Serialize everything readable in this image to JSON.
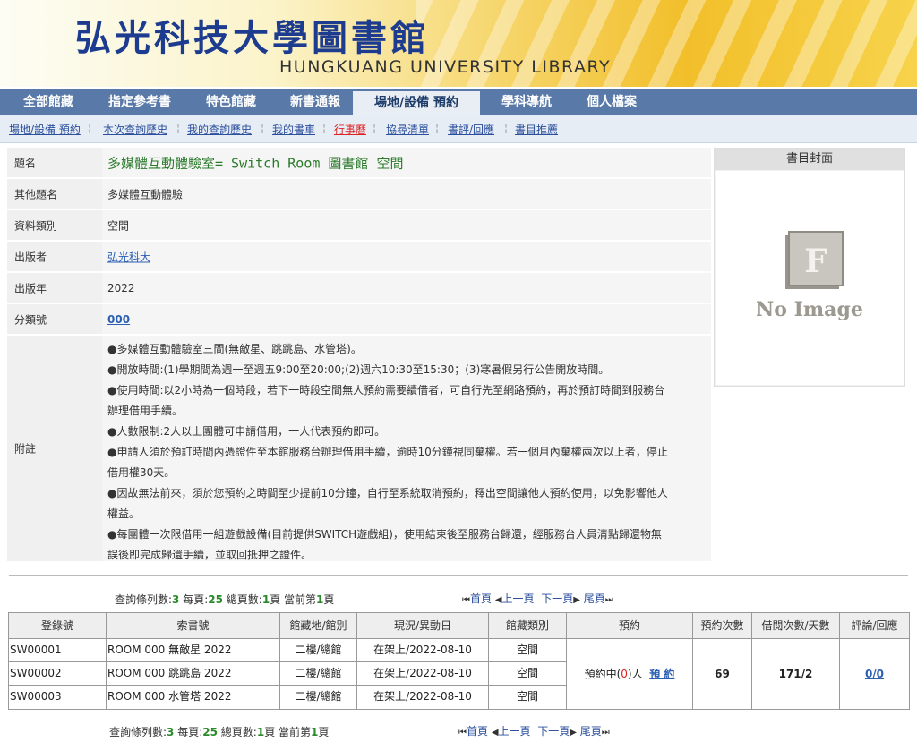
{
  "banner": {
    "title": "弘光科技大學圖書館",
    "subtitle": "HUNGKUANG UNIVERSITY LIBRARY"
  },
  "main_nav": [
    {
      "label": "全部館藏"
    },
    {
      "label": "指定參考書"
    },
    {
      "label": "特色館藏"
    },
    {
      "label": "新書通報"
    },
    {
      "label": "場地/設備 預約",
      "active": true
    },
    {
      "label": "學科導航"
    },
    {
      "label": "個人檔案"
    }
  ],
  "sub_nav": [
    {
      "label": "場地/設備 預約"
    },
    {
      "label": "本次查詢歷史"
    },
    {
      "label": "我的查詢歷史"
    },
    {
      "label": "我的書車"
    },
    {
      "label": "行事曆",
      "color": "#dd2222"
    },
    {
      "label": "協尋清單"
    },
    {
      "label": "書評/回應"
    },
    {
      "label": "書目推薦"
    }
  ],
  "record": {
    "title_label": "題名",
    "title": "多媒體互動體驗室= Switch Room 圖書館 空間",
    "other_title_label": "其他題名",
    "other_title": "多媒體互動體驗",
    "type_label": "資料類別",
    "type": "空間",
    "publisher_label": "出版者",
    "publisher": "弘光科大",
    "year_label": "出版年",
    "year": "2022",
    "class_label": "分類號",
    "class_no": "000",
    "notes_label": "附註",
    "notes": [
      "●多媒體互動體驗室三間(無敵星、跳跳島、水管塔)。",
      "●開放時間:(1)學期間為週一至週五9:00至20:00;(2)週六10:30至15:30；(3)寒暑假另行公告開放時間。",
      "●使用時間:以2小時為一個時段，若下一時段空間無人預約需要續借者，可自行先至網路預約，再於預訂時間到服務台",
      "辦理借用手續。",
      "●人數限制:2人以上團體可申請借用，一人代表預約即可。",
      "●申請人須於預訂時間內憑證件至本館服務台辦理借用手續，逾時10分鐘視同棄權。若一個月內棄權兩次以上者，停止",
      "借用權30天。",
      "●因故無法前來，須於您預約之時間至少提前10分鐘，自行至系統取消預約，釋出空間讓他人預約使用，以免影響他人",
      "權益。",
      "●每團體一次限借用一組遊戲設備(目前提供SWITCH遊戲組)，使用結束後至服務台歸還，經服務台人員清點歸還物無",
      "誤後即完成歸還手續，並取回抵押之證件。"
    ]
  },
  "cover": {
    "header": "書目封面",
    "placeholder": "No Image",
    "placeholder_letter": "F"
  },
  "pager": {
    "total_label": "查詢條列數:",
    "total": "3",
    "per_page_label": " 每頁:",
    "per_page": "25",
    "pages_label": " 總頁數:",
    "pages": "1",
    "current_label": "頁 當前第",
    "current": "1",
    "current_suffix": "頁",
    "first": "首頁",
    "prev": "上一頁",
    "next": "下一頁",
    "last": "尾頁"
  },
  "holdings": {
    "headers": [
      "登錄號",
      "索書號",
      "館藏地/館別",
      "現況/異動日",
      "館藏類別",
      "預約",
      "預約次數",
      "借閱次數/天數",
      "評論/回應"
    ],
    "rows": [
      {
        "barcode": "SW00001",
        "call_no": "ROOM 000 無敵星 2022",
        "location": "二樓/總館",
        "status": "在架上/2022-08-10",
        "category": "空間"
      },
      {
        "barcode": "SW00002",
        "call_no": "ROOM 000 跳跳島 2022",
        "location": "二樓/總館",
        "status": "在架上/2022-08-10",
        "category": "空間"
      },
      {
        "barcode": "SW00003",
        "call_no": "ROOM 000 水管塔 2022",
        "location": "二樓/總館",
        "status": "在架上/2022-08-10",
        "category": "空間"
      }
    ],
    "reserve_text_1": "預約中(",
    "reserve_count": "0",
    "reserve_text_2": ")人",
    "reserve_link": "預 約",
    "reservations": "69",
    "loans": "171/2",
    "reviews": "0/0"
  }
}
